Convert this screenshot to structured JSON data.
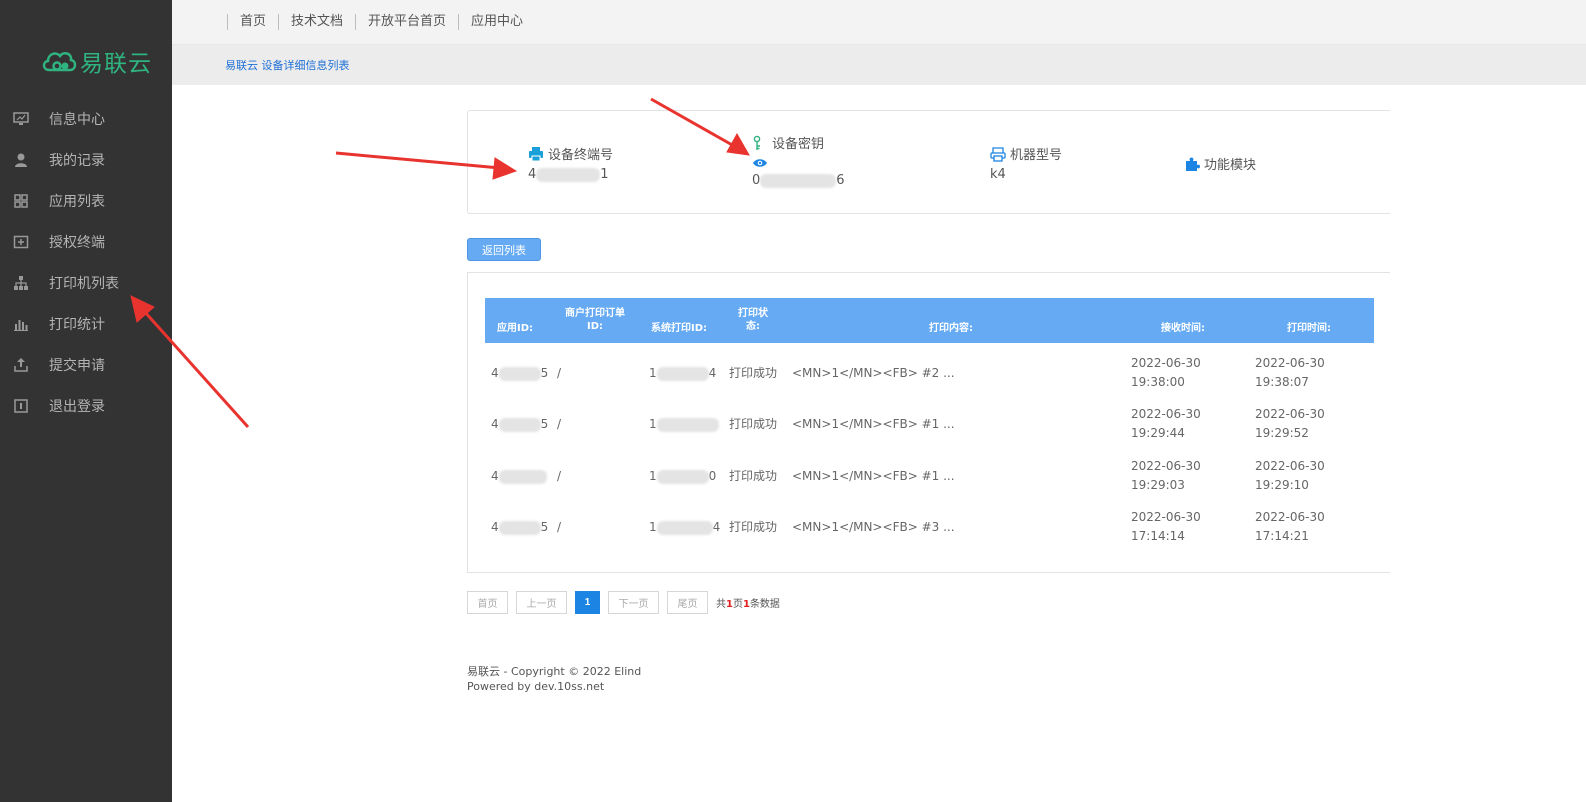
{
  "brand": {
    "name": "易联云",
    "color": "#2fb380"
  },
  "sidebar": {
    "items": [
      {
        "label": "信息中心",
        "icon": "monitor-icon"
      },
      {
        "label": "我的记录",
        "icon": "user-icon"
      },
      {
        "label": "应用列表",
        "icon": "grid-icon"
      },
      {
        "label": "授权终端",
        "icon": "plus-square-icon"
      },
      {
        "label": "打印机列表",
        "icon": "sitemap-icon"
      },
      {
        "label": "打印统计",
        "icon": "bar-chart-icon"
      },
      {
        "label": "提交申请",
        "icon": "upload-icon"
      },
      {
        "label": "退出登录",
        "icon": "logout-icon"
      }
    ]
  },
  "topnav": {
    "links": [
      "首页",
      "技术文档",
      "开放平台首页",
      "应用中心"
    ]
  },
  "breadcrumb": "易联云 设备详细信息列表",
  "device": {
    "terminal": {
      "label": "设备终端号",
      "value_prefix": "4",
      "value_suffix": "1"
    },
    "secret": {
      "label": "设备密钥",
      "value_prefix": "0",
      "value_suffix": "6"
    },
    "model": {
      "label": "机器型号",
      "value": "k4"
    },
    "modules": {
      "label": "功能模块"
    }
  },
  "back_button": "返回列表",
  "table": {
    "headers": {
      "app_id": "应用ID:",
      "order_id": "商户打印订单ID:",
      "sys_id": "系统打印ID:",
      "status": "打印状态:",
      "content": "打印内容:",
      "received": "接收时间:",
      "printed": "打印时间:"
    },
    "rows": [
      {
        "app_prefix": "4",
        "app_suffix": "5",
        "order": "/",
        "sys_prefix": "1",
        "sys_suffix": "4",
        "status": "打印成功",
        "content": "<MN>1</MN><FB> #2 ...",
        "received_date": "2022-06-30",
        "received_time": "19:38:00",
        "printed_date": "2022-06-30",
        "printed_time": "19:38:07"
      },
      {
        "app_prefix": "4",
        "app_suffix": "5",
        "order": "/",
        "sys_prefix": "1",
        "sys_suffix": "",
        "status": "打印成功",
        "content": "<MN>1</MN><FB> #1 ...",
        "received_date": "2022-06-30",
        "received_time": "19:29:44",
        "printed_date": "2022-06-30",
        "printed_time": "19:29:52"
      },
      {
        "app_prefix": "4",
        "app_suffix": "",
        "order": "/",
        "sys_prefix": "1",
        "sys_suffix": "0",
        "status": "打印成功",
        "content": "<MN>1</MN><FB> #1 ...",
        "received_date": "2022-06-30",
        "received_time": "19:29:03",
        "printed_date": "2022-06-30",
        "printed_time": "19:29:10"
      },
      {
        "app_prefix": "4",
        "app_suffix": "5",
        "order": "/",
        "sys_prefix": "1",
        "sys_suffix": "4",
        "status": "打印成功",
        "content": "<MN>1</MN><FB> #3 ...",
        "received_date": "2022-06-30",
        "received_time": "17:14:14",
        "printed_date": "2022-06-30",
        "printed_time": "17:14:21"
      }
    ]
  },
  "pagination": {
    "first": "首页",
    "prev": "上一页",
    "current": "1",
    "next": "下一页",
    "last": "尾页",
    "summary_prefix": "共",
    "pages": "1",
    "summary_mid": "页",
    "count": "1",
    "summary_suffix": "条数据"
  },
  "footer": {
    "copyright": "易联云 - Copyright © 2022 Elind",
    "powered": "Powered by dev.10ss.net"
  },
  "colors": {
    "sidebar_bg": "#333333",
    "accent_blue": "#66aaf3",
    "active_page": "#1c84e3",
    "arrow_red": "#e8332e"
  }
}
